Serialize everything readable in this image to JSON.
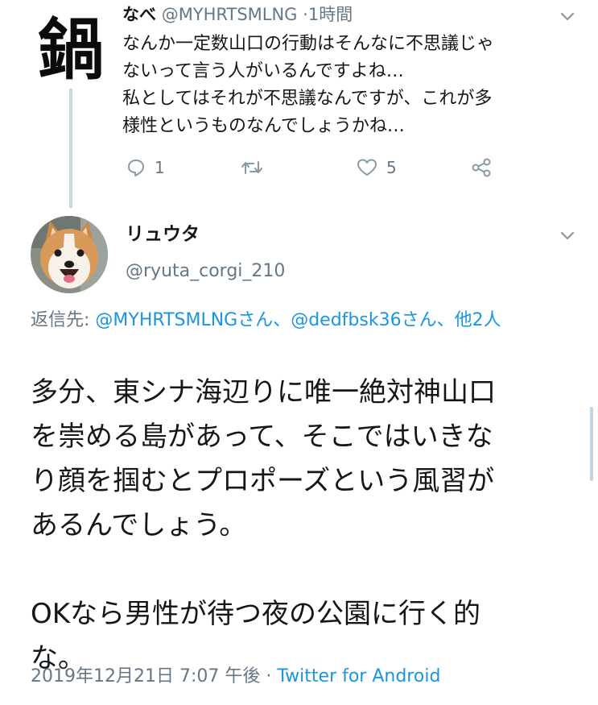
{
  "parent_tweet": {
    "avatar_text": "鍋",
    "name": "なべ",
    "handle": "@MYHRTSMLNG",
    "separator": "·",
    "time": "1時間",
    "text": "なんか一定数山口の行動はそんなに不思議じゃ\nないって言う人がいるんですよね…\n私としてはそれが不思議なんですが、これが多\n様性というものなんでしょうかね…",
    "actions": {
      "reply_count": "1",
      "retweet_count": "",
      "like_count": "5"
    }
  },
  "reply_tweet": {
    "name": "リュウタ",
    "handle": "@ryuta_corgi_210",
    "reply_to_label": "返信先:",
    "reply_to_mentions": "@MYHRTSMLNGさん、@dedfbsk36さん、他2人",
    "text": "多分、東シナ海辺りに唯一絶対神山口\nを崇める島があって、そこではいきな\nり顔を掴むとプロポーズという風習が\nあるんでしょう。\n\nOKなら男性が待つ夜の公園に行く的\nな。",
    "timestamp": "2019年12月21日 7:07 午後",
    "separator": "·",
    "source": "Twitter for Android"
  },
  "icons": {
    "caret": "chevron-down-icon",
    "reply": "reply-icon",
    "retweet": "retweet-icon",
    "like": "heart-icon",
    "share": "share-icon"
  },
  "colors": {
    "text": "#14171a",
    "secondary": "#657786",
    "link": "#1b95e0",
    "thread_line": "#ccd6dd",
    "icon": "#8899a6"
  }
}
